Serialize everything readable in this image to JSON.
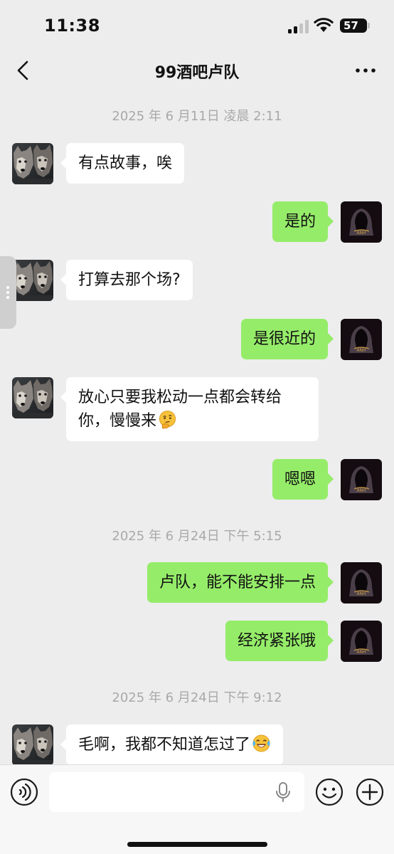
{
  "status_bar": {
    "time": "11:38",
    "battery": "57"
  },
  "header": {
    "title": "99酒吧卢队"
  },
  "messages": [
    {
      "type": "time",
      "text": "2025 年 6 月11日 凌晨 2:11"
    },
    {
      "type": "in",
      "text": "有点故事，唉"
    },
    {
      "type": "out",
      "text": "是的"
    },
    {
      "type": "in",
      "text": "打算去那个场?"
    },
    {
      "type": "out",
      "text": "是很近的"
    },
    {
      "type": "in",
      "text": "放心只要我松动一点都会转给你，慢慢来",
      "emoji": "thinking-face"
    },
    {
      "type": "out",
      "text": "嗯嗯"
    },
    {
      "type": "time",
      "text": "2025 年 6 月24日 下午 5:15"
    },
    {
      "type": "out",
      "text": "卢队，能不能安排一点"
    },
    {
      "type": "out",
      "text": "经济紧张哦"
    },
    {
      "type": "time",
      "text": "2025 年 6 月24日 下午 9:12"
    },
    {
      "type": "in",
      "text": "毛啊，我都不知道怎过了",
      "emoji": "crying-laughing-face"
    }
  ],
  "input": {
    "placeholder": ""
  },
  "colors": {
    "background": "#ededed",
    "outgoing_bubble": "#95ec69",
    "incoming_bubble": "#ffffff",
    "timestamp": "#a9a9a9"
  }
}
